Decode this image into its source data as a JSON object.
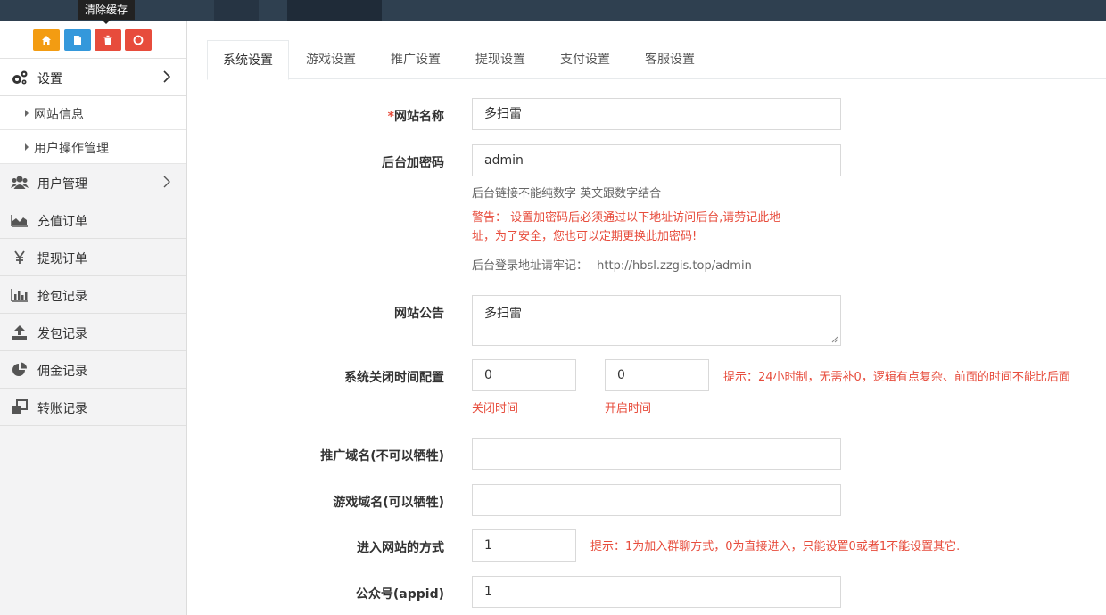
{
  "quickbar": {
    "tooltip": "清除缓存"
  },
  "sidebar": {
    "settings": "设置",
    "sub": [
      "网站信息",
      "用户操作管理"
    ],
    "items": [
      "用户管理",
      "充值订单",
      "提现订单",
      "抢包记录",
      "发包记录",
      "佣金记录",
      "转账记录"
    ]
  },
  "tabs": [
    "系统设置",
    "游戏设置",
    "推广设置",
    "提现设置",
    "支付设置",
    "客服设置"
  ],
  "form": {
    "site_name_label": "网站名称",
    "site_name_value": "多扫雷",
    "encrypt_label": "后台加密码",
    "encrypt_value": "admin",
    "encrypt_help": "后台链接不能纯数字 英文跟数字结合",
    "warn_line1": "警告： 设置加密码后必须通过以下地址访问后台,请劳记此地",
    "warn_line2": "址，为了安全，您也可以定期更换此加密码!",
    "login_url_prefix": "后台登录地址请牢记：",
    "login_url": "http://hbsl.zzgis.top/admin",
    "notice_label": "网站公告",
    "notice_value": "多扫雷",
    "close_time_label": "系统关闭时间配置",
    "close_value": "0",
    "open_value": "0",
    "close_caption": "关闭时间",
    "open_caption": "开启时间",
    "time_hint": "提示：24小时制，无需补0，逻辑有点复杂、前面的时间不能比后面",
    "promo_domain_label": "推广域名(不可以牺牲)",
    "promo_domain_value": "",
    "game_domain_label": "游戏域名(可以牺牲)",
    "game_domain_value": "",
    "enter_label": "进入网站的方式",
    "enter_value": "1",
    "enter_hint": "提示：1为加入群聊方式，0为直接进入，只能设置0或者1不能设置其它.",
    "appid_label": "公众号(appid)",
    "appid_value": "1"
  }
}
